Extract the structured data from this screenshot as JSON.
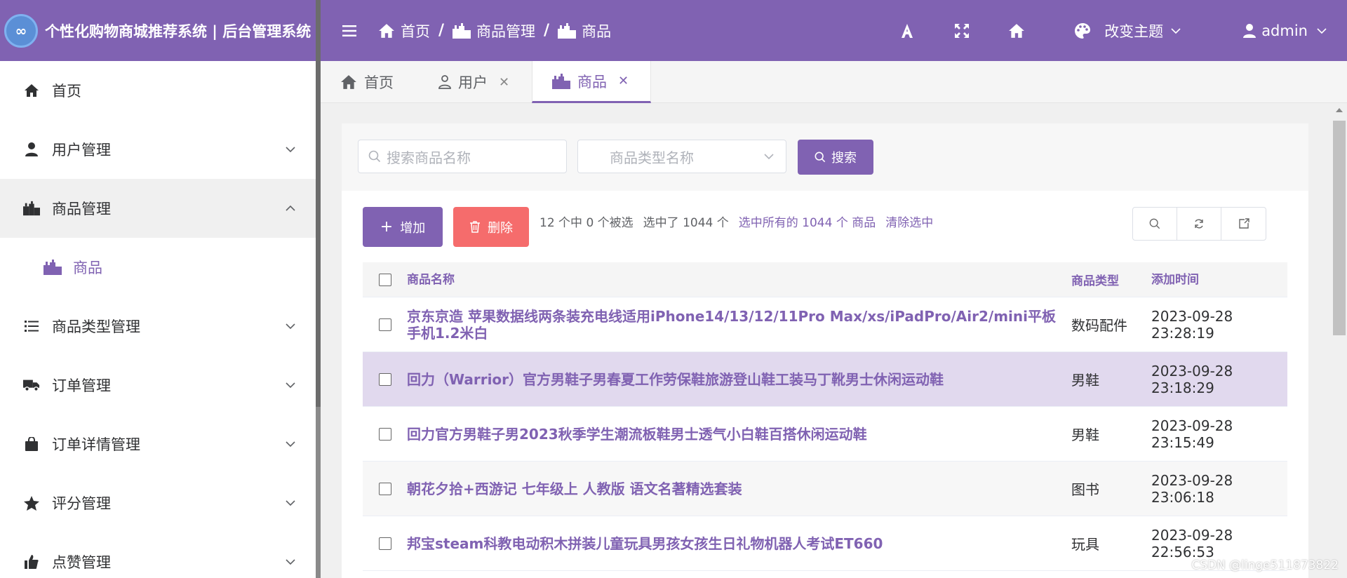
{
  "brand": {
    "logo": "∞",
    "title": "个性化购物商城推荐系统 | 后台管理系统"
  },
  "sidebar": {
    "items": [
      {
        "label": "首页",
        "icon": "home-icon"
      },
      {
        "label": "用户管理",
        "icon": "user-icon"
      },
      {
        "label": "商品管理",
        "icon": "goods-icon"
      },
      {
        "label": "商品",
        "icon": "goods-icon"
      },
      {
        "label": "商品类型管理",
        "icon": "list-icon"
      },
      {
        "label": "订单管理",
        "icon": "truck-icon"
      },
      {
        "label": "订单详情管理",
        "icon": "bag-icon"
      },
      {
        "label": "评分管理",
        "icon": "star-icon"
      },
      {
        "label": "点赞管理",
        "icon": "thumbs-up-icon"
      }
    ]
  },
  "header": {
    "breadcrumbs": [
      "首页",
      "商品管理",
      "商品"
    ],
    "theme_label": "改变主题",
    "user": "admin"
  },
  "tabs": [
    {
      "label": "首页"
    },
    {
      "label": "用户"
    },
    {
      "label": "商品"
    }
  ],
  "search": {
    "name_placeholder": "搜索商品名称",
    "type_placeholder": "商品类型名称",
    "button": "搜索"
  },
  "toolbar": {
    "add": "增加",
    "delete": "删除",
    "selection_status": "12 个中 0 个被选",
    "selected_count": "选中了 1044 个",
    "select_all": "选中所有的 1044 个 商品",
    "clear": "清除选中"
  },
  "table": {
    "headers": {
      "name": "商品名称",
      "type": "商品类型",
      "time": "添加时间"
    },
    "rows": [
      {
        "name": "京东京造 苹果数据线两条装充电线适用iPhone14/13/12/11Pro Max/xs/iPadPro/Air2/mini平板手机1.2米白",
        "type": "数码配件",
        "date": "2023-09-28",
        "time": "23:28:19"
      },
      {
        "name": "回力（Warrior）官方男鞋子男春夏工作劳保鞋旅游登山鞋工装马丁靴男士休闲运动鞋",
        "type": "男鞋",
        "date": "2023-09-28",
        "time": "23:18:29"
      },
      {
        "name": "回力官方男鞋子男2023秋季学生潮流板鞋男士透气小白鞋百搭休闲运动鞋",
        "type": "男鞋",
        "date": "2023-09-28",
        "time": "23:15:49"
      },
      {
        "name": "朝花夕拾+西游记 七年级上 人教版 语文名著精选套装",
        "type": "图书",
        "date": "2023-09-28",
        "time": "23:06:18"
      },
      {
        "name": "邦宝steam科教电动积木拼装儿童玩具男孩女孩生日礼物机器人考试ET660",
        "type": "玩具",
        "date": "2023-09-28",
        "time": "22:56:53"
      }
    ]
  },
  "watermark": "CSDN @linge511873822",
  "colors": {
    "primary": "#8062b2",
    "danger": "#f56c6c",
    "highlight_row": "#e1d9ee"
  }
}
